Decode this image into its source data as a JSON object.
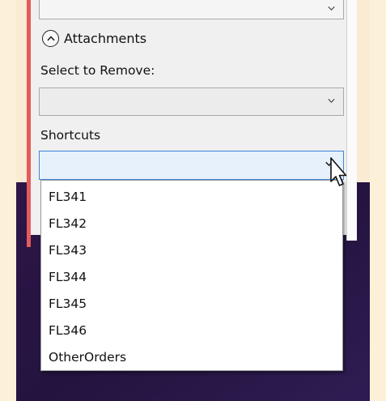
{
  "attachments": {
    "label": "Attachments",
    "toggle_icon": "chevron-up-icon"
  },
  "remove": {
    "label": "Select to Remove:",
    "value": ""
  },
  "shortcuts": {
    "label": "Shortcuts",
    "value": "",
    "options": [
      "FL341",
      "FL342",
      "FL343",
      "FL344",
      "FL345",
      "FL346",
      "OtherOrders"
    ]
  },
  "colors": {
    "accent": "#e45b5b",
    "focus_border": "#3d86d9",
    "focused_fill": "#e7f1fb"
  }
}
